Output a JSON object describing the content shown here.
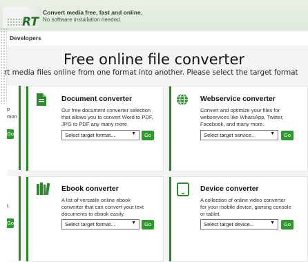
{
  "header": {
    "logo": "RT",
    "tagline_main": "Convert media free, fast and online.",
    "tagline_sub": "No software installation needed."
  },
  "nav": {
    "item": "Developers"
  },
  "page": {
    "title": "Free online file converter",
    "subtitle": "rt media files online from one format into another. Please select the target format"
  },
  "left_partial": {
    "top_lines": [
      "p",
      "mon"
    ],
    "top_go": "Go",
    "bottom_line": "t.",
    "bottom_go": "Go"
  },
  "cards": {
    "document": {
      "title": "Document converter",
      "desc": [
        "Our free document converter selection",
        "that allows you to convert Word to PDF,",
        "JPG to PDF any many more."
      ],
      "select": "Select target format...",
      "go": "Go",
      "icon": "document-icon"
    },
    "webservice": {
      "title": "Webservice converter",
      "desc": [
        "Convert and optimize your files for",
        "webservices like WhatsApp, Twitter,",
        "Facebook, and many more."
      ],
      "select": "Select target service...",
      "go": "Go",
      "icon": "globe-icon"
    },
    "ebook": {
      "title": "Ebook converter",
      "desc": [
        "A list of versatile online ebook",
        "converter that can convert your text",
        "documents to ebook easily."
      ],
      "select": "Select target format...",
      "go": "Go",
      "icon": "books-icon"
    },
    "device": {
      "title": "Device converter",
      "desc": [
        "A collection of online video converter",
        "for your mobile device, gaming console",
        "or tablet."
      ],
      "select": "Select target device...",
      "go": "Go",
      "icon": "tablet-icon"
    }
  },
  "colors": {
    "accent": "#2a8a2a",
    "button": "#2e9a2e"
  }
}
